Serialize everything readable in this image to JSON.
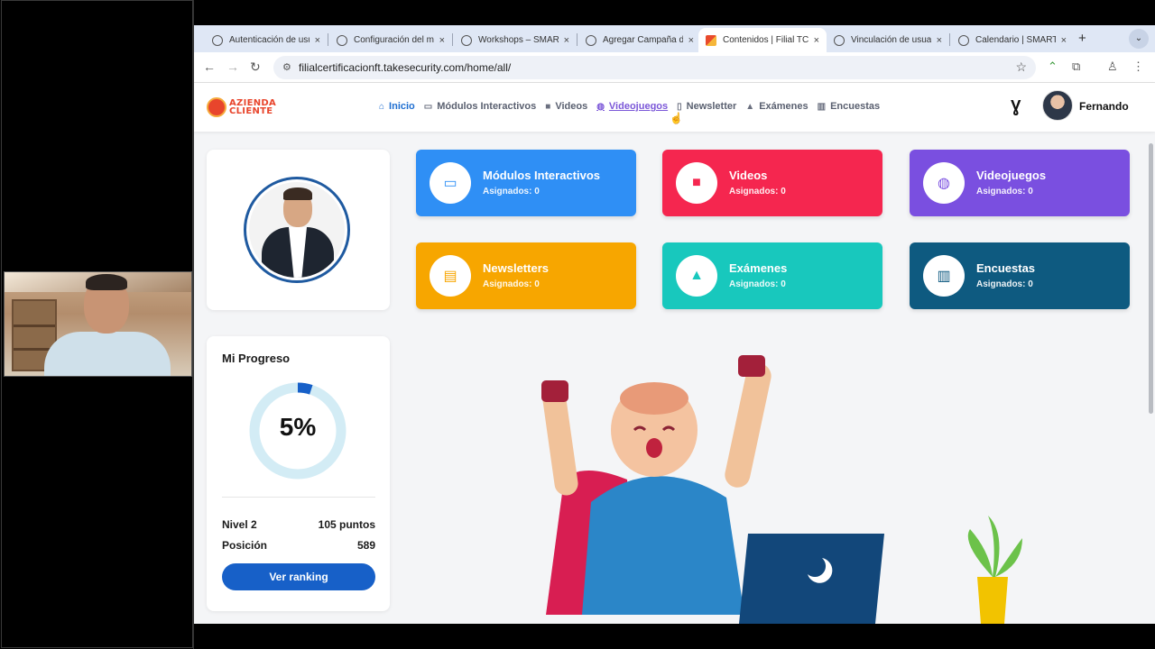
{
  "browser": {
    "tabs": [
      {
        "title": "Autenticación de usu",
        "active": false
      },
      {
        "title": "Configuración del m",
        "active": false
      },
      {
        "title": "Workshops – SMAR",
        "active": false
      },
      {
        "title": "Agregar Campaña d",
        "active": false
      },
      {
        "title": "Contenidos | Filial TC",
        "active": true
      },
      {
        "title": "Vinculación de usua",
        "active": false
      },
      {
        "title": "Calendario | SMART",
        "active": false
      }
    ],
    "close_glyph": "×",
    "new_tab_glyph": "+",
    "menu_glyph": "⌄",
    "back_glyph": "←",
    "forward_glyph": "→",
    "reload_glyph": "↻",
    "site_info_glyph": "⚙",
    "url": "filialcertificacionft.takesecurity.com/home/all/",
    "star_glyph": "☆"
  },
  "header": {
    "logo_line1": "AZIENDA",
    "logo_line2": "CLIENTE",
    "nav": [
      {
        "label": "Inicio",
        "icon": "home-icon",
        "glyph": "⌂",
        "state": "active"
      },
      {
        "label": "Módulos Interactivos",
        "icon": "laptop-icon",
        "glyph": "▭",
        "state": "normal"
      },
      {
        "label": "Videos",
        "icon": "video-icon",
        "glyph": "■",
        "state": "normal"
      },
      {
        "label": "Videojuegos",
        "icon": "gamepad-icon",
        "glyph": "◍",
        "state": "hover"
      },
      {
        "label": "Newsletter",
        "icon": "document-icon",
        "glyph": "▯",
        "state": "normal"
      },
      {
        "label": "Exámenes",
        "icon": "graduation-cap-icon",
        "glyph": "▲",
        "state": "normal"
      },
      {
        "label": "Encuestas",
        "icon": "bar-chart-icon",
        "glyph": "▥",
        "state": "normal"
      }
    ],
    "medal_glyph": "Ɣ",
    "user_name": "Fernando"
  },
  "progress": {
    "title": "Mi Progreso",
    "percent_value": 5,
    "percent_label": "5%",
    "level_label": "Nivel 2",
    "points_label": "105 puntos",
    "position_label": "Posición",
    "position_value": "589",
    "ranking_button": "Ver ranking"
  },
  "categories": [
    {
      "title": "Módulos Interactivos",
      "sub": "Asignados: 0",
      "color": "#2f8ff5",
      "icon": "laptop-icon",
      "glyph": "▭"
    },
    {
      "title": "Videos",
      "sub": "Asignados: 0",
      "color": "#f5264f",
      "icon": "video-camera-icon",
      "glyph": "■"
    },
    {
      "title": "Videojuegos",
      "sub": "Asignados: 0",
      "color": "#7a4fe0",
      "icon": "gamepad-icon",
      "glyph": "◍"
    },
    {
      "title": "Newsletters",
      "sub": "Asignados: 0",
      "color": "#f7a600",
      "icon": "document-icon",
      "glyph": "▤"
    },
    {
      "title": "Exámenes",
      "sub": "Asignados: 0",
      "color": "#18c8bd",
      "icon": "graduation-cap-icon",
      "glyph": "▲"
    },
    {
      "title": "Encuestas",
      "sub": "Asignados: 0",
      "color": "#0e5a80",
      "icon": "bar-chart-icon",
      "glyph": "▥"
    }
  ],
  "colors": {
    "ring_track": "#d3ecf5",
    "ring_fill": "#1760c8",
    "accent": "#1760c8"
  }
}
